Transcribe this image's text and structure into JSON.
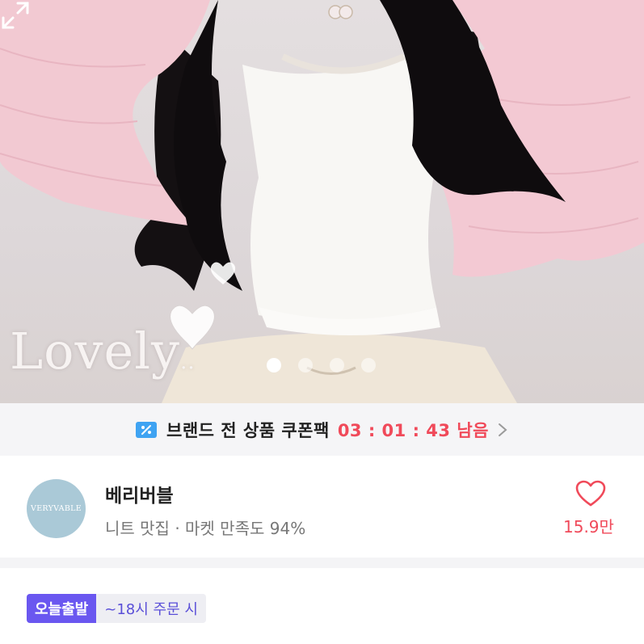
{
  "hero": {
    "overlay_text": "Lovely",
    "overlay_trail": "..",
    "carousel_pages": 4,
    "carousel_active": 1
  },
  "coupon": {
    "label": "브랜드 전 상품 쿠폰팩",
    "timer": "03 : 01 : 43 남음",
    "icon": "coupon-percent-icon"
  },
  "shop": {
    "logo_text": "VERYVABLE",
    "name": "베리버블",
    "subtitle": "니트 맛집 · 마켓 만족도 94%",
    "likes": "15.9만"
  },
  "delivery": {
    "badge": "오늘출발",
    "condition": "~18시 주문 시"
  },
  "colors": {
    "accent_red": "#f04a5a",
    "badge_purple": "#6a57f0",
    "logo_blue": "#aac9d7"
  }
}
